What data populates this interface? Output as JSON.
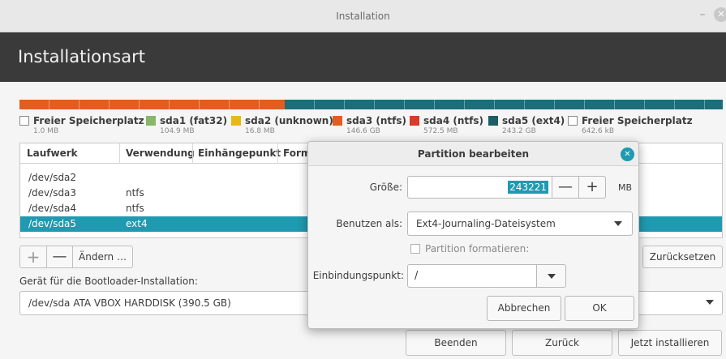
{
  "window": {
    "title": "Installation",
    "minimize_glyph": "–",
    "close_glyph": "✕"
  },
  "header": {
    "heading": "Installationsart"
  },
  "legend": [
    {
      "name": "Freier Speicherplatz",
      "size": "1.0 MB",
      "color": "#ffffff",
      "empty": true
    },
    {
      "name": "sda1 (fat32)",
      "size": "104.9 MB",
      "color": "#87b868",
      "empty": false
    },
    {
      "name": "sda2 (unknown)",
      "size": "16.8 MB",
      "color": "#e8b81a",
      "empty": false
    },
    {
      "name": "sda3 (ntfs)",
      "size": "146.6 GB",
      "color": "#e35d1f",
      "empty": false
    },
    {
      "name": "sda4 (ntfs)",
      "size": "572.5 MB",
      "color": "#d93a2a",
      "empty": false
    },
    {
      "name": "sda5 (ext4)",
      "size": "243.2 GB",
      "color": "#1b5e66",
      "empty": false
    },
    {
      "name": "Freier Speicherplatz",
      "size": "642.6 kB",
      "color": "#ffffff",
      "empty": true
    }
  ],
  "table": {
    "headers": [
      "Laufwerk",
      "Verwendung",
      "Einhängepunkt",
      "Form"
    ],
    "rows": [
      {
        "device": "/dev/sda2",
        "usage": ""
      },
      {
        "device": "/dev/sda3",
        "usage": "ntfs"
      },
      {
        "device": "/dev/sda4",
        "usage": "ntfs"
      },
      {
        "device": "/dev/sda5",
        "usage": "ext4",
        "selected": true
      }
    ]
  },
  "toolbar": {
    "add_glyph": "+",
    "remove_glyph": "—",
    "change_label": "Ändern …",
    "reset_label": "Zurücksetzen"
  },
  "bootloader": {
    "label": "Gerät für die Bootloader-Installation:",
    "value": "/dev/sda   ATA VBOX HARDDISK (390.5 GB)"
  },
  "footer": {
    "quit_label": "Beenden",
    "back_label": "Zurück",
    "install_label": "Jetzt installieren"
  },
  "dialog": {
    "title": "Partition bearbeiten",
    "close_glyph": "✕",
    "size_label": "Größe:",
    "size_value": "243221",
    "minus_glyph": "—",
    "plus_glyph": "+",
    "size_unit": "MB",
    "use_label": "Benutzen als:",
    "use_value": "Ext4-Journaling-Dateisystem",
    "format_label": "Partition formatieren:",
    "mount_label": "Einbindungspunkt:",
    "mount_value": "/",
    "cancel_label": "Abbrechen",
    "ok_label": "OK"
  },
  "colors": {
    "accent": "#1f9ab0",
    "header_bg": "#3a3a3a",
    "partition_ntfs": "#e35d1f",
    "partition_ext4": "#1b6e7a"
  }
}
